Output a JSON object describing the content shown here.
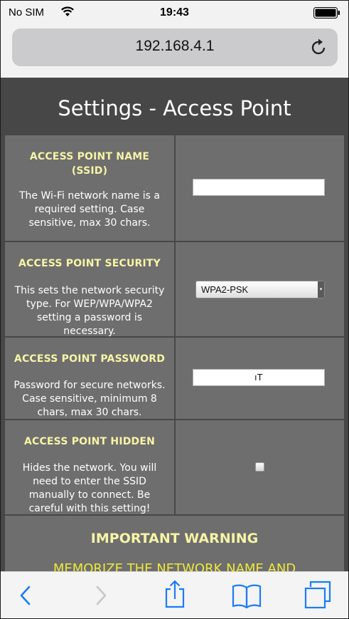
{
  "status_bar": {
    "carrier": "No SIM",
    "time": "19:43",
    "wifi_icon": "wifi-icon",
    "battery_icon": "battery-icon"
  },
  "browser": {
    "url": "192.168.4.1",
    "reload_icon": "reload-icon",
    "toolbar": [
      "back-icon",
      "forward-icon",
      "share-icon",
      "bookmarks-icon",
      "tabs-icon"
    ],
    "colors": {
      "accent": "#1a7cf5",
      "disabled": "#c6c6c8"
    }
  },
  "page": {
    "title": "Settings - Access Point",
    "rows": [
      {
        "title_line1": "ACCESS POINT NAME",
        "title_line2": "(SSID)",
        "desc_lines": [
          "The Wi-Fi network name is a",
          "required setting. Case",
          "sensitive, max 30 chars."
        ],
        "control": "text",
        "value": ""
      },
      {
        "title_line1": "ACCESS POINT SECURITY",
        "desc_lines": [
          "This sets the network security",
          "type. For WEP/WPA/WPA2",
          "setting a password is",
          "necessary."
        ],
        "control": "select",
        "value": "WPA2-PSK"
      },
      {
        "title_line1": "ACCESS POINT PASSWORD",
        "desc_lines": [
          "Password for secure networks.",
          "Case sensitive, minimum 8",
          "chars, max 30 chars."
        ],
        "control": "text",
        "value": "ıT"
      },
      {
        "title_line1": "ACCESS POINT HIDDEN",
        "desc_lines": [
          "Hides the network. You will",
          "need to enter the SSID",
          "manually to connect. Be",
          "careful with this setting!"
        ],
        "control": "checkbox",
        "checked": false
      }
    ],
    "warning": {
      "title": "IMPORTANT WARNING",
      "body": "MEMORIZE THE NETWORK NAME AND"
    },
    "colors": {
      "background": "#474747",
      "cell": "#6e6e6e",
      "heading": "#f7f4a6",
      "warning_text": "#f0e83a"
    }
  }
}
